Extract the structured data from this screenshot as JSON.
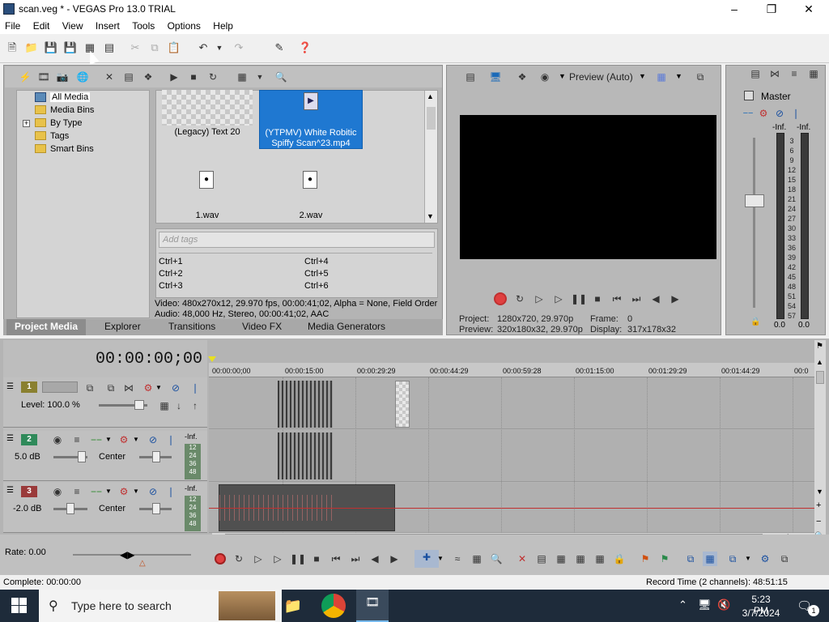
{
  "window": {
    "title": "scan.veg * - VEGAS Pro 13.0 TRIAL"
  },
  "menu": [
    "File",
    "Edit",
    "View",
    "Insert",
    "Tools",
    "Options",
    "Help"
  ],
  "media_tree": {
    "items": [
      {
        "label": "All Media",
        "selected": true
      },
      {
        "label": "Media Bins"
      },
      {
        "label": "By Type",
        "expand": "+"
      },
      {
        "label": "Tags"
      },
      {
        "label": "Smart Bins"
      }
    ]
  },
  "media_grid": {
    "items": [
      {
        "label": "(Legacy) Text 20"
      },
      {
        "label": "(YTPMV) White Robitic Spiffy Scan^23.mp4",
        "selected": true
      },
      {
        "label": "1.wav"
      },
      {
        "label": "2.wav"
      }
    ]
  },
  "tags": {
    "placeholder": "Add tags",
    "shortcuts": [
      "Ctrl+1",
      "Ctrl+4",
      "Ctrl+2",
      "Ctrl+5",
      "Ctrl+3",
      "Ctrl+6"
    ]
  },
  "media_info": {
    "video": "Video: 480x270x12, 29.970 fps, 00:00:41;02, Alpha = None, Field Order",
    "audio": "Audio: 48,000 Hz, Stereo, 00:00:41;02, AAC"
  },
  "tabs": [
    "Project Media",
    "Explorer",
    "Transitions",
    "Video FX",
    "Media Generators"
  ],
  "preview": {
    "mode": "Preview (Auto)",
    "project_label": "Project:",
    "project_value": "1280x720, 29.970p",
    "preview_label": "Preview:",
    "preview_value": "320x180x32, 29.970p",
    "frame_label": "Frame:",
    "frame_value": "0",
    "display_label": "Display:",
    "display_value": "317x178x32"
  },
  "master": {
    "title": "Master",
    "inf_left": "-Inf.",
    "inf_right": "-Inf.",
    "scale": [
      "3",
      "6",
      "9",
      "12",
      "15",
      "18",
      "21",
      "24",
      "27",
      "30",
      "33",
      "36",
      "39",
      "42",
      "45",
      "48",
      "51",
      "54",
      "57"
    ],
    "value_left": "0.0",
    "value_right": "0.0"
  },
  "timeline": {
    "timecode": "00:00:00;00",
    "ruler": [
      "00:00:00;00",
      "00:00:15:00",
      "00:00:29:29",
      "00:00:44:29",
      "00:00:59:28",
      "00:01:15:00",
      "00:01:29:29",
      "00:01:44:29",
      "00:0"
    ],
    "tracks": [
      {
        "num": "1",
        "color": "#8a8030",
        "level": "Level: 100.0 %"
      },
      {
        "num": "2",
        "color": "#2f8a5a",
        "vol": "5.0 dB",
        "pan": "Center",
        "meter_top": "-Inf.",
        "meter_scale": [
          "12",
          "24",
          "36",
          "48"
        ]
      },
      {
        "num": "3",
        "color": "#9a3a3a",
        "vol": "-2.0 dB",
        "pan": "Center",
        "meter_top": "-Inf.",
        "meter_scale": [
          "12",
          "24",
          "36",
          "48"
        ]
      }
    ],
    "rate": "Rate: 0.00"
  },
  "status": {
    "left": "Complete: 00:00:00",
    "right": "Record Time (2 channels): 48:51:15"
  },
  "taskbar": {
    "search_placeholder": "Type here to search",
    "time": "5:23 PM",
    "date": "3/7/2024",
    "notifications": "1"
  }
}
